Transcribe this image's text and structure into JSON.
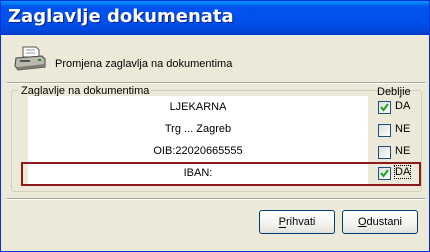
{
  "window": {
    "title": "Zaglavlje dokumenata"
  },
  "header": {
    "icon": "printer-icon",
    "text": "Promjena zaglavlja na dokumentima"
  },
  "group": {
    "legend": "Zaglavlje na dokumentima",
    "bold_column_label": "Debljie",
    "rows": [
      {
        "text": "LJEKARNA",
        "bold": true,
        "bold_label": "DA"
      },
      {
        "text": "Trg ... Zagreb",
        "bold": false,
        "bold_label": "NE"
      },
      {
        "text": "OIB:22020665555",
        "bold": false,
        "bold_label": "NE"
      },
      {
        "text": "IBAN:",
        "bold": true,
        "bold_label": "DA"
      }
    ]
  },
  "buttons": {
    "accept": {
      "label": "Prihvati",
      "mnemonic": "P"
    },
    "cancel": {
      "label": "Odustani",
      "mnemonic": "O"
    }
  },
  "colors": {
    "titlebar": "#0054e3",
    "highlight_border": "#8b1a1a",
    "window_bg": "#ece9d8"
  }
}
